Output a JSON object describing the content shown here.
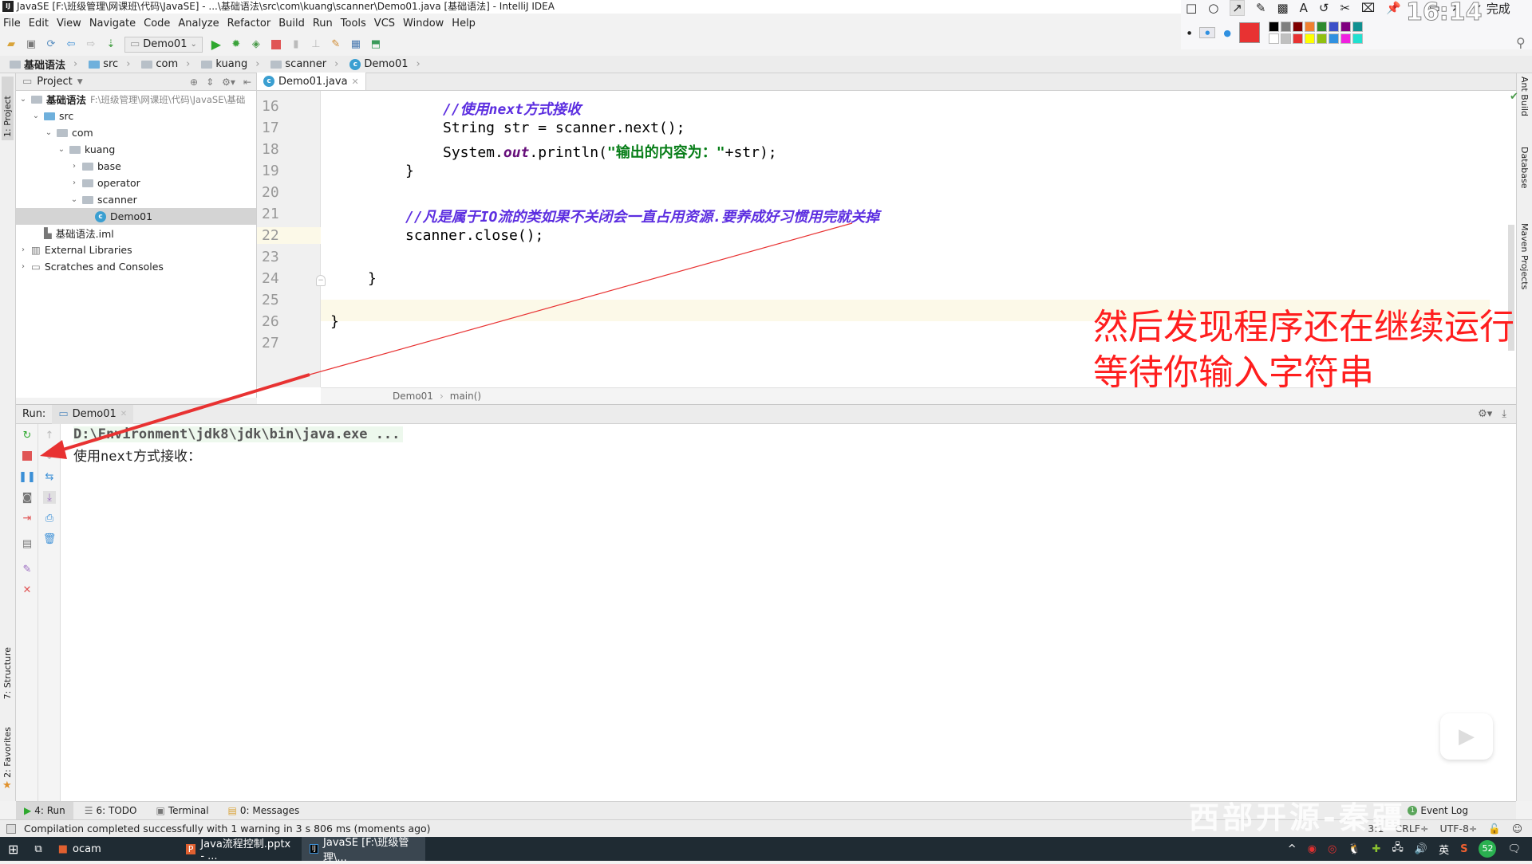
{
  "window": {
    "title": "JavaSE [F:\\班级管理\\网课班\\代码\\JavaSE] - ...\\基础语法\\src\\com\\kuang\\scanner\\Demo01.java [基础语法] - IntelliJ IDEA",
    "app_logo": "IJ"
  },
  "menu": [
    "File",
    "Edit",
    "View",
    "Navigate",
    "Code",
    "Analyze",
    "Refactor",
    "Build",
    "Run",
    "Tools",
    "VCS",
    "Window",
    "Help"
  ],
  "toolbar": {
    "run_config": "Demo01",
    "icons": [
      "open-icon",
      "save-icon",
      "sync-icon",
      "back-icon",
      "forward-icon",
      "build-icon",
      "run-icon",
      "debug-icon",
      "coverage-icon",
      "stop-icon",
      "sdk-icon",
      "structure-icon",
      "settings-icon",
      "project-structure-icon",
      "update-icon"
    ]
  },
  "breadcrumbs": [
    "基础语法",
    "src",
    "com",
    "kuang",
    "scanner",
    "Demo01"
  ],
  "project_panel": {
    "title": "Project",
    "tree": [
      {
        "label": "基础语法",
        "hint": "F:\\班级管理\\网课班\\代码\\JavaSE\\基础",
        "depth": 0,
        "expanded": true,
        "type": "module"
      },
      {
        "label": "src",
        "depth": 1,
        "expanded": true,
        "type": "folder-blue"
      },
      {
        "label": "com",
        "depth": 2,
        "expanded": true,
        "type": "folder"
      },
      {
        "label": "kuang",
        "depth": 3,
        "expanded": true,
        "type": "folder"
      },
      {
        "label": "base",
        "depth": 4,
        "expanded": false,
        "type": "folder"
      },
      {
        "label": "operator",
        "depth": 4,
        "expanded": false,
        "type": "folder"
      },
      {
        "label": "scanner",
        "depth": 4,
        "expanded": true,
        "type": "folder"
      },
      {
        "label": "Demo01",
        "depth": 5,
        "type": "class",
        "selected": true
      },
      {
        "label": "基础语法.iml",
        "depth": 1,
        "type": "iml"
      },
      {
        "label": "External Libraries",
        "depth": 0,
        "expanded": false,
        "type": "lib"
      },
      {
        "label": "Scratches and Consoles",
        "depth": 0,
        "expanded": false,
        "type": "scratch"
      }
    ]
  },
  "editor": {
    "tab": "Demo01.java",
    "line_numbers": [
      "16",
      "17",
      "18",
      "19",
      "20",
      "21",
      "22",
      "23",
      "24",
      "25",
      "26",
      "27"
    ],
    "current_line": "22",
    "code": {
      "l16": "//使用next方式接收",
      "l17": "String str = scanner.next();",
      "l18_a": "System.",
      "l18_b": "out",
      "l18_c": ".println(",
      "l18_d": "\"输出的内容为：\"",
      "l18_e": "+str);",
      "l19": "}",
      "l21": "//凡是属于IO流的类如果不关闭会一直占用资源.要养成好习惯用完就关掉",
      "l22": "scanner.close();",
      "l24": "}",
      "l26": "}"
    },
    "footer_breadcrumb": [
      "Demo01",
      "main()"
    ]
  },
  "annotation": {
    "line1": "然后发现程序还在继续运行",
    "line2": "等待你输入字符串",
    "color": "#ff1e1e"
  },
  "run_panel": {
    "label": "Run:",
    "tab": "Demo01",
    "console": [
      "D:\\Environment\\jdk8\\jdk\\bin\\java.exe ...",
      "使用next方式接收："
    ]
  },
  "side_tabs_left": [
    "1: Project",
    "7: Structure",
    "2: Favorites"
  ],
  "side_tabs_right": [
    "Ant Build",
    "Database",
    "Maven Projects"
  ],
  "bottom_tabs": [
    "4: Run",
    "6: TODO",
    "Terminal",
    "0: Messages"
  ],
  "event_log": {
    "label": "Event Log",
    "count": "1"
  },
  "status": {
    "message": "Compilation completed successfully with 1 warning in 3 s 806 ms (moments ago)",
    "position": "3:1",
    "line_sep": "CRLF÷",
    "encoding": "UTF-8÷"
  },
  "taskbar": {
    "items": [
      "ocam",
      "Java流程控制.pptx - ...",
      "JavaSE [F:\\班级管理\\..."
    ],
    "tray_lang": "英",
    "tray_badge": "52"
  },
  "snip_tool": {
    "done_label": "完成",
    "timer": "16:14",
    "swatches": [
      "#000000",
      "#7f7f7f",
      "#7f0000",
      "#f08030",
      "#2e8b2e",
      "#3c50c8",
      "#800080",
      "#109090",
      "#ffffff",
      "#c0c0c0",
      "#e83232",
      "#ffff00",
      "#90c010",
      "#3090e0",
      "#f020e0",
      "#20e0d0"
    ],
    "selected_color": "#e83232"
  },
  "watermark": "西部开源-秦疆"
}
